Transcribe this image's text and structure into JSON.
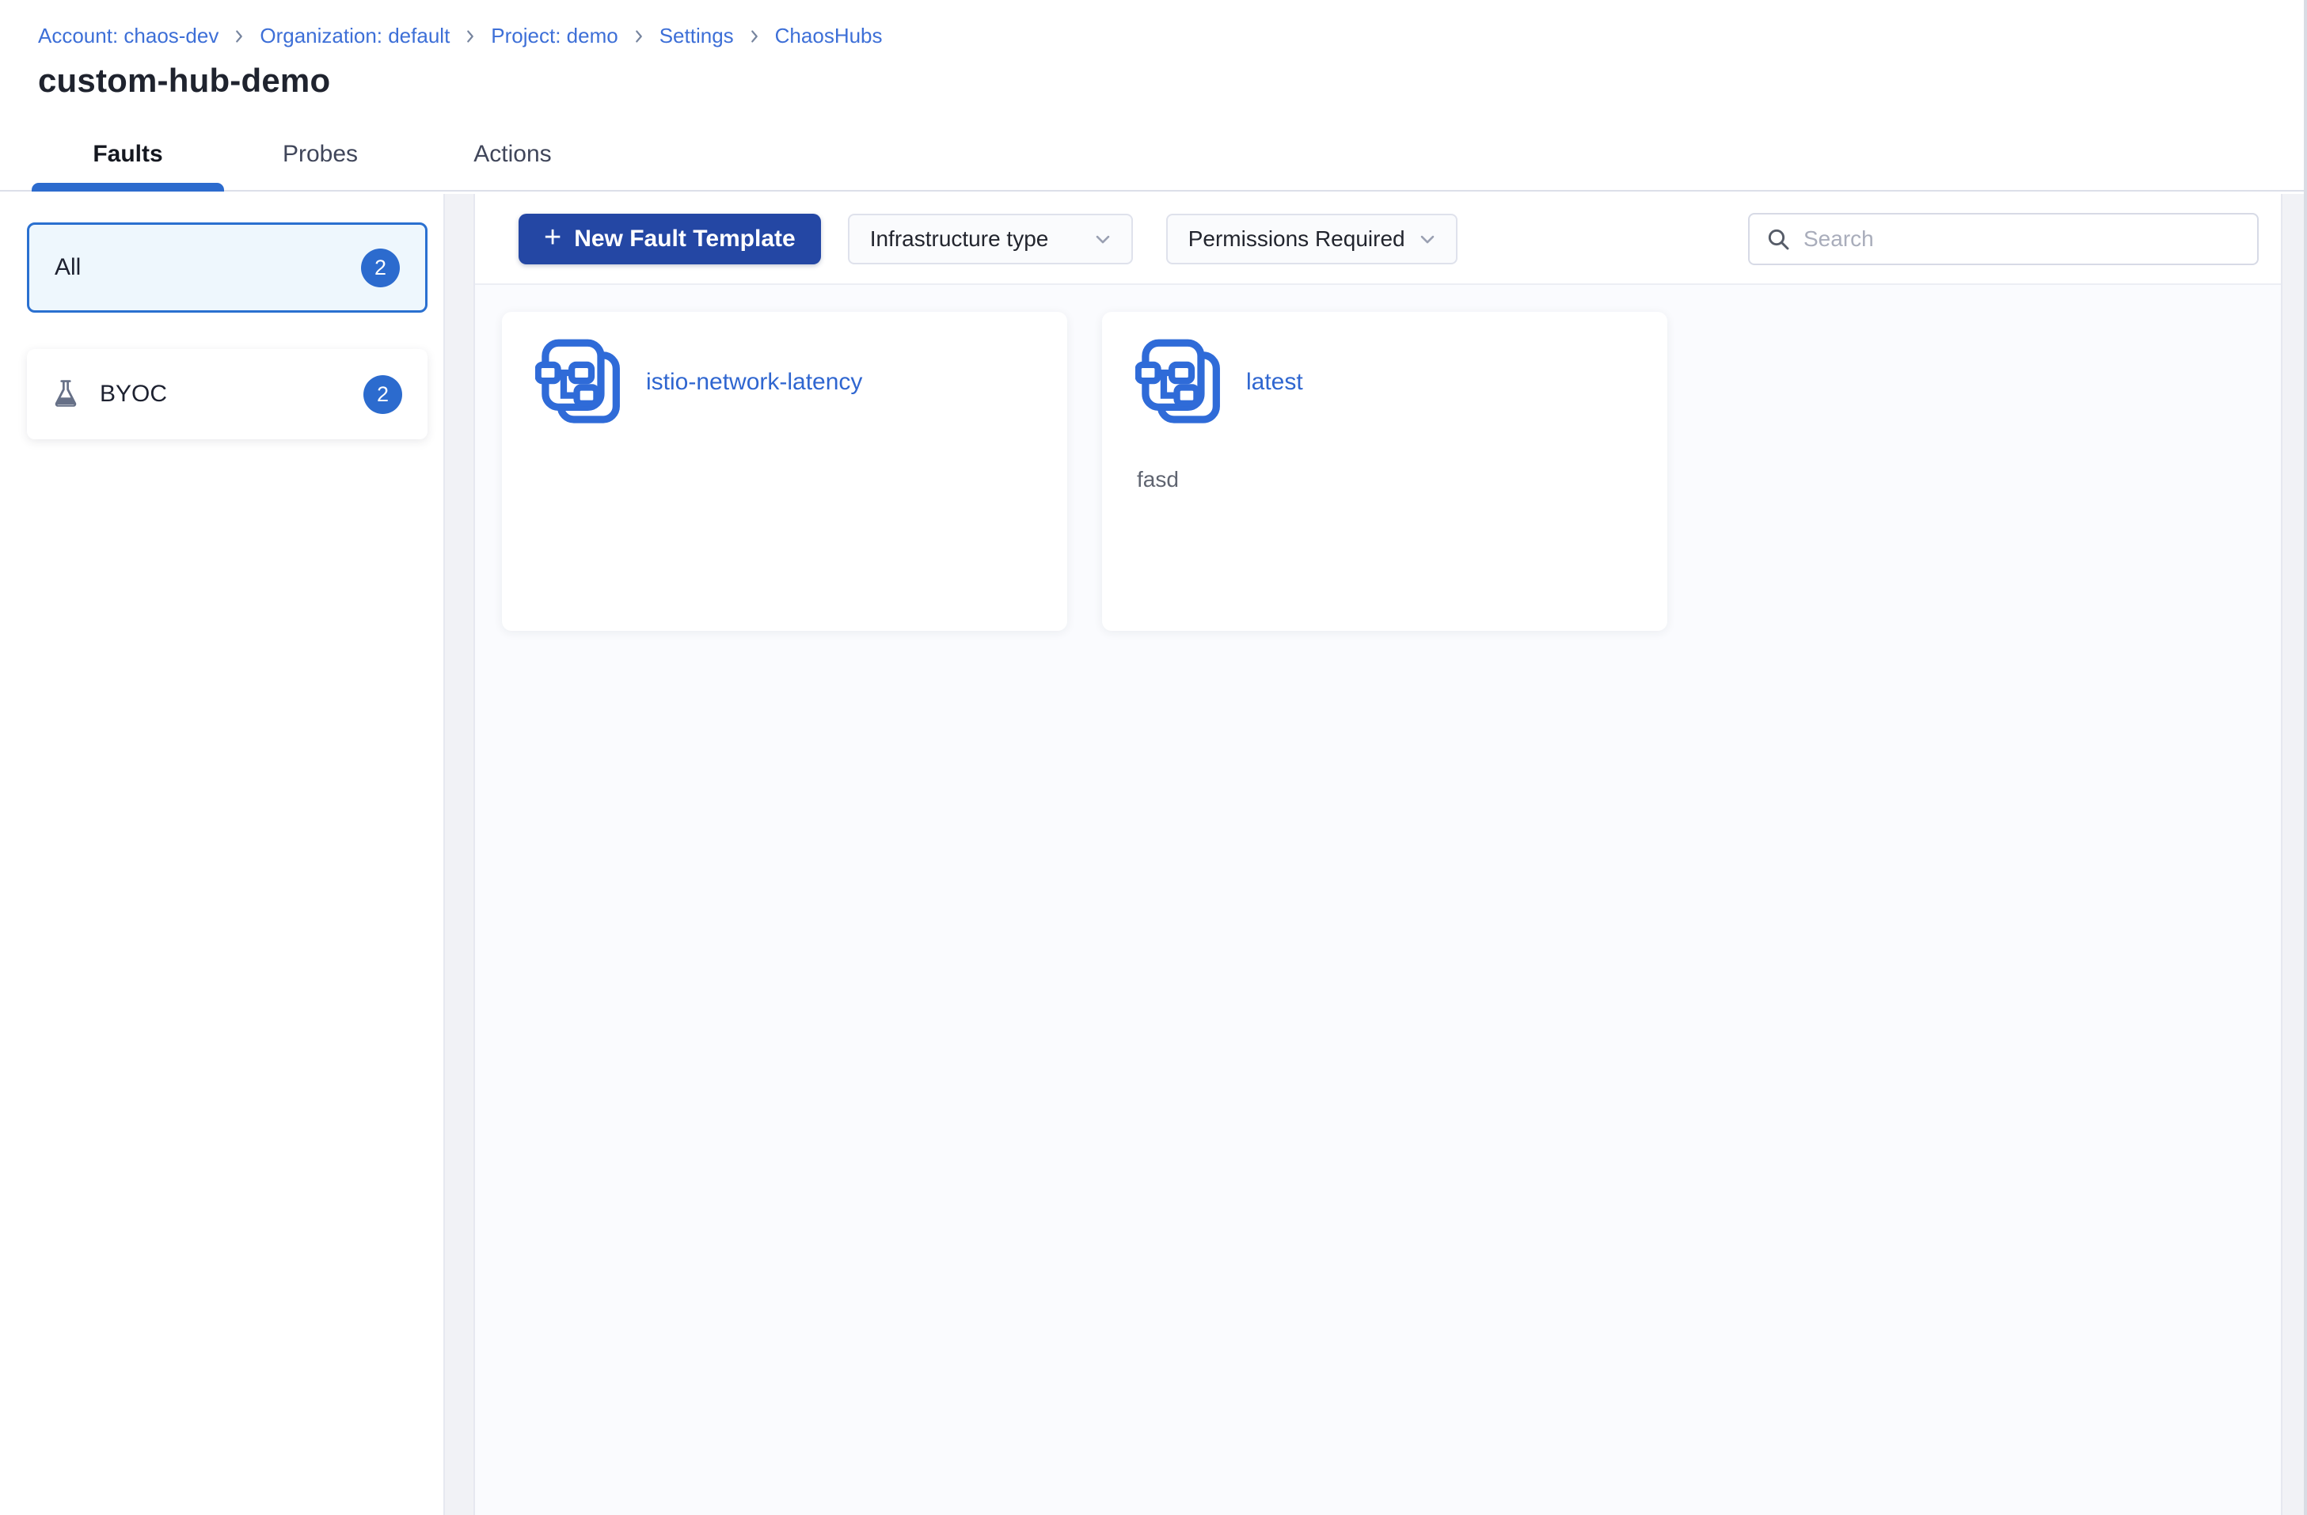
{
  "breadcrumb": {
    "items": [
      {
        "label": "Account: chaos-dev"
      },
      {
        "label": "Organization: default"
      },
      {
        "label": "Project: demo"
      },
      {
        "label": "Settings"
      },
      {
        "label": "ChaosHubs"
      }
    ]
  },
  "page": {
    "title": "custom-hub-demo"
  },
  "tabs": [
    {
      "label": "Faults",
      "active": true
    },
    {
      "label": "Probes",
      "active": false
    },
    {
      "label": "Actions",
      "active": false
    }
  ],
  "sidebar": {
    "filters": [
      {
        "label": "All",
        "count": "2",
        "active": true,
        "icon": null
      },
      {
        "label": "BYOC",
        "count": "2",
        "active": false,
        "icon": "flask-icon"
      }
    ]
  },
  "toolbar": {
    "new_fault_template": {
      "plus": "+",
      "label": "New Fault Template"
    },
    "dropdowns": [
      {
        "label": "Infrastructure type"
      },
      {
        "label": "Permissions Required"
      }
    ],
    "search": {
      "placeholder": "Search",
      "value": ""
    }
  },
  "cards": [
    {
      "title": "istio-network-latency",
      "description": ""
    },
    {
      "title": "latest",
      "description": "fasd"
    }
  ],
  "colors": {
    "link_blue": "#3d6fd7",
    "accent_blue": "#2c6bce",
    "button_blue": "#2447a4",
    "icon_blue": "#2f6bd8",
    "active_filter_bg": "#eef7fd",
    "active_filter_border": "#2a70d0",
    "panel_bg": "#fafbfe",
    "frame_bg": "#f1f2f6",
    "flask_gray": "#667087"
  }
}
